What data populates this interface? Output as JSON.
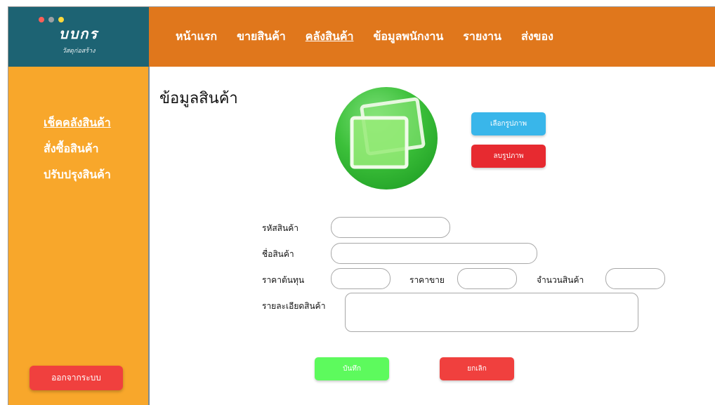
{
  "brand": {
    "name": "บบกร",
    "subtitle": "วัสดุก่อสร้าง",
    "dot_colors": [
      "#ff5f57",
      "#9ba0a4",
      "#ffd93b"
    ]
  },
  "topnav": {
    "items": [
      {
        "label": "หน้าแรก",
        "active": false
      },
      {
        "label": "ขายสินค้า",
        "active": false
      },
      {
        "label": "คลังสินค้า",
        "active": true
      },
      {
        "label": "ข้อมูลพนักงาน",
        "active": false
      },
      {
        "label": "รายงาน",
        "active": false
      },
      {
        "label": "ส่งของ",
        "active": false
      }
    ]
  },
  "sidebar": {
    "items": [
      {
        "label": "เช็คคลังสินค้า",
        "active": true
      },
      {
        "label": "สั่งซื้อสินค้า",
        "active": false
      },
      {
        "label": "ปรับปรุงสินค้า",
        "active": false
      }
    ],
    "logout_label": "ออกจากระบบ"
  },
  "main": {
    "title": "ข้อมูลสินค้า",
    "image_buttons": {
      "choose_label": "เลือกรูปภาพ",
      "delete_label": "ลบรูปภาพ"
    },
    "form": {
      "product_code_label": "รหัสสินค้า",
      "product_code_value": "",
      "product_name_label": "ชื่อสินค้า",
      "product_name_value": "",
      "cost_price_label": "ราคาต้นทุน",
      "cost_price_value": "",
      "sale_price_label": "ราคาขาย",
      "sale_price_value": "",
      "quantity_label": "จำนวนสินค้า",
      "quantity_value": "",
      "details_label": "รายละเอียดสินค้า",
      "details_value": ""
    },
    "save_label": "บันทึก",
    "cancel_label": "ยกเลิก"
  },
  "colors": {
    "logo_bg": "#1d6373",
    "nav_bg": "#e0771c",
    "sidebar_bg": "#f8a72b",
    "choose_button": "#39b6ea",
    "delete_button": "#e72a30",
    "save_button": "#5dfa5d",
    "cancel_button": "#f0403e"
  }
}
